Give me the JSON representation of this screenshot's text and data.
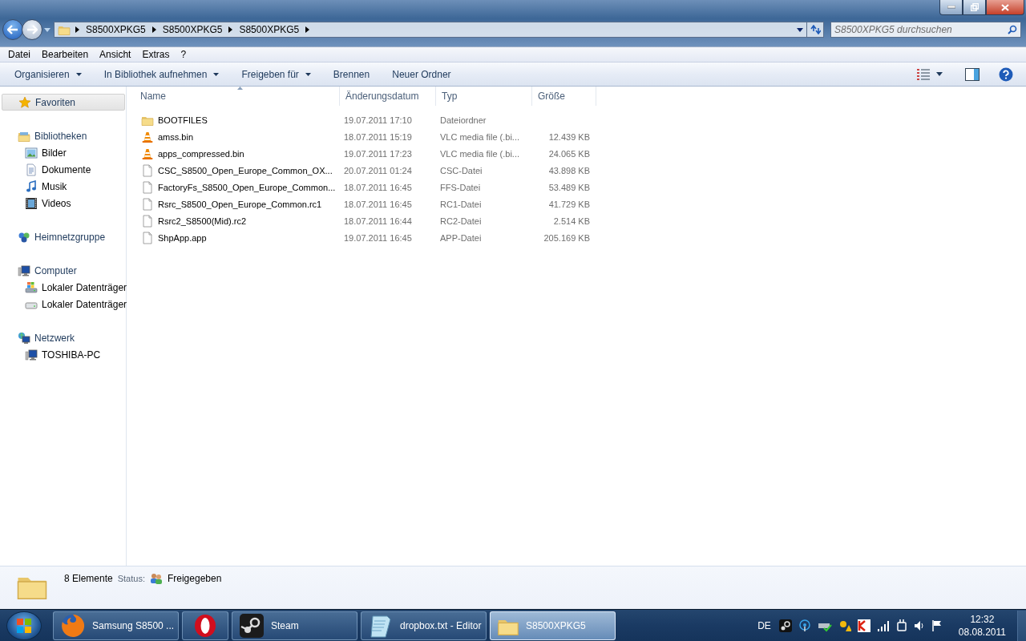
{
  "address_bar": {
    "breadcrumbs": [
      "S8500XPKG5",
      "S8500XPKG5",
      "S8500XPKG5"
    ]
  },
  "search": {
    "placeholder": "S8500XPKG5 durchsuchen"
  },
  "menu": [
    "Datei",
    "Bearbeiten",
    "Ansicht",
    "Extras",
    "?"
  ],
  "toolbar": [
    {
      "label": "Organisieren",
      "dropdown": true
    },
    {
      "label": "In Bibliothek aufnehmen",
      "dropdown": true
    },
    {
      "label": "Freigeben für",
      "dropdown": true
    },
    {
      "label": "Brennen",
      "dropdown": false
    },
    {
      "label": "Neuer Ordner",
      "dropdown": false
    }
  ],
  "sidebar": {
    "groups": [
      {
        "kind": "star",
        "label": "Favoriten",
        "selected": true
      },
      {
        "kind": "library",
        "label": "Bibliotheken",
        "selected": false,
        "children": [
          {
            "kind": "pictures",
            "label": "Bilder",
            "selected": false
          },
          {
            "kind": "documents",
            "label": "Dokumente",
            "selected": false
          },
          {
            "kind": "music",
            "label": "Musik",
            "selected": false
          },
          {
            "kind": "videos",
            "label": "Videos",
            "selected": false
          }
        ]
      },
      {
        "kind": "homegroup",
        "label": "Heimnetzgruppe",
        "selected": false
      },
      {
        "kind": "computer",
        "label": "Computer",
        "selected": false,
        "children": [
          {
            "kind": "windrive",
            "label": "Lokaler Datenträger",
            "selected": false
          },
          {
            "kind": "drive",
            "label": "Lokaler Datenträger",
            "selected": false
          }
        ]
      },
      {
        "kind": "network",
        "label": "Netzwerk",
        "selected": false,
        "children": [
          {
            "kind": "computer",
            "label": "TOSHIBA-PC",
            "selected": false
          }
        ]
      }
    ]
  },
  "table": {
    "columns": [
      {
        "label": "Name",
        "sorted": true
      },
      {
        "label": "Änderungsdatum",
        "sorted": false
      },
      {
        "label": "Typ",
        "sorted": false
      },
      {
        "label": "Größe",
        "sorted": false
      }
    ],
    "rows": [
      {
        "kind": "folder",
        "name": "BOOTFILES",
        "date": "19.07.2011 17:10",
        "type": "Dateiordner"
      },
      {
        "kind": "vlc",
        "name": "amss.bin",
        "date": "18.07.2011 15:19",
        "type": "VLC media file (.bi...",
        "size": "12.439 KB"
      },
      {
        "kind": "vlc",
        "name": "apps_compressed.bin",
        "date": "19.07.2011 17:23",
        "type": "VLC media file (.bi...",
        "size": "24.065 KB"
      },
      {
        "kind": "file",
        "name": "CSC_S8500_Open_Europe_Common_OX...",
        "date": "20.07.2011 01:24",
        "type": "CSC-Datei",
        "size": "43.898 KB"
      },
      {
        "kind": "file",
        "name": "FactoryFs_S8500_Open_Europe_Common...",
        "date": "18.07.2011 16:45",
        "type": "FFS-Datei",
        "size": "53.489 KB"
      },
      {
        "kind": "file",
        "name": "Rsrc_S8500_Open_Europe_Common.rc1",
        "date": "18.07.2011 16:45",
        "type": "RC1-Datei",
        "size": "41.729 KB"
      },
      {
        "kind": "file",
        "name": "Rsrc2_S8500(Mid).rc2",
        "date": "18.07.2011 16:44",
        "type": "RC2-Datei",
        "size": "2.514 KB"
      },
      {
        "kind": "file",
        "name": "ShpApp.app",
        "date": "19.07.2011 16:45",
        "type": "APP-Datei",
        "size": "205.169 KB"
      }
    ]
  },
  "details": {
    "count": "8 Elemente",
    "status_label": "Status:",
    "status": "Freigegeben"
  },
  "taskbar": {
    "items": [
      {
        "kind": "firefox",
        "label": "Samsung S8500 ...",
        "selected": false
      },
      {
        "kind": "opera",
        "selected": false
      },
      {
        "kind": "steam",
        "label": "Steam",
        "selected": false
      },
      {
        "kind": "notepad",
        "label": "dropbox.txt - Editor",
        "selected": false
      },
      {
        "kind": "folder",
        "label": "S8500XPKG5",
        "selected": true
      }
    ],
    "language": "DE",
    "time": "12:32",
    "date": "08.08.2011"
  }
}
